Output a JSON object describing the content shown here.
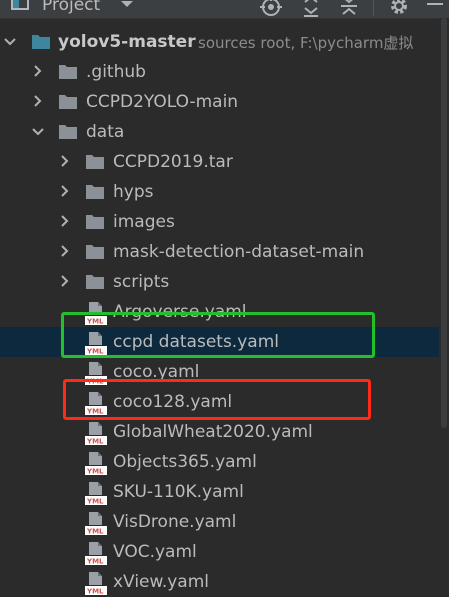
{
  "toolbar": {
    "title": "Project",
    "icons": [
      "project-view-icon",
      "dropdown-icon",
      "locate-icon",
      "expand-all-icon",
      "collapse-all-icon",
      "gear-icon",
      "minimize-icon"
    ]
  },
  "root": {
    "name": "yolov5-master",
    "hint": "sources root,  F:\\pycharm虚拟"
  },
  "items": [
    {
      "label": "yolov5-master",
      "type": "root-folder",
      "level": 0,
      "expanded": true
    },
    {
      "label": ".github",
      "type": "folder",
      "level": 1,
      "expanded": false
    },
    {
      "label": "CCPD2YOLO-main",
      "type": "folder",
      "level": 1,
      "expanded": false
    },
    {
      "label": "data",
      "type": "folder",
      "level": 1,
      "expanded": true
    },
    {
      "label": "CCPD2019.tar",
      "type": "folder",
      "level": 2,
      "expanded": false
    },
    {
      "label": "hyps",
      "type": "folder",
      "level": 2,
      "expanded": false
    },
    {
      "label": "images",
      "type": "folder",
      "level": 2,
      "expanded": false
    },
    {
      "label": "mask-detection-dataset-main",
      "type": "folder",
      "level": 2,
      "expanded": false
    },
    {
      "label": "scripts",
      "type": "folder",
      "level": 2,
      "expanded": false
    },
    {
      "label": "Argoverse.yaml",
      "type": "yaml",
      "level": 2
    },
    {
      "label": "ccpd datasets.yaml",
      "type": "yaml",
      "level": 2,
      "selected": true
    },
    {
      "label": "coco.yaml",
      "type": "yaml",
      "level": 2
    },
    {
      "label": "coco128.yaml",
      "type": "yaml",
      "level": 2
    },
    {
      "label": "GlobalWheat2020.yaml",
      "type": "yaml",
      "level": 2
    },
    {
      "label": "Objects365.yaml",
      "type": "yaml",
      "level": 2
    },
    {
      "label": "SKU-110K.yaml",
      "type": "yaml",
      "level": 2
    },
    {
      "label": "VisDrone.yaml",
      "type": "yaml",
      "level": 2
    },
    {
      "label": "VOC.yaml",
      "type": "yaml",
      "level": 2
    },
    {
      "label": "xView.yaml",
      "type": "yaml",
      "level": 2
    }
  ],
  "yaml_badge": "YML",
  "colors": {
    "background": "#2b2b2b",
    "selection": "#0d293e",
    "folder": "#8c9198",
    "root_folder": "#3e86a0",
    "highlight_green": "#22c02a",
    "highlight_red": "#ff2a18"
  },
  "annotations": [
    {
      "target": "ccpd datasets.yaml",
      "color": "green"
    },
    {
      "target": "coco128.yaml",
      "color": "red"
    }
  ]
}
